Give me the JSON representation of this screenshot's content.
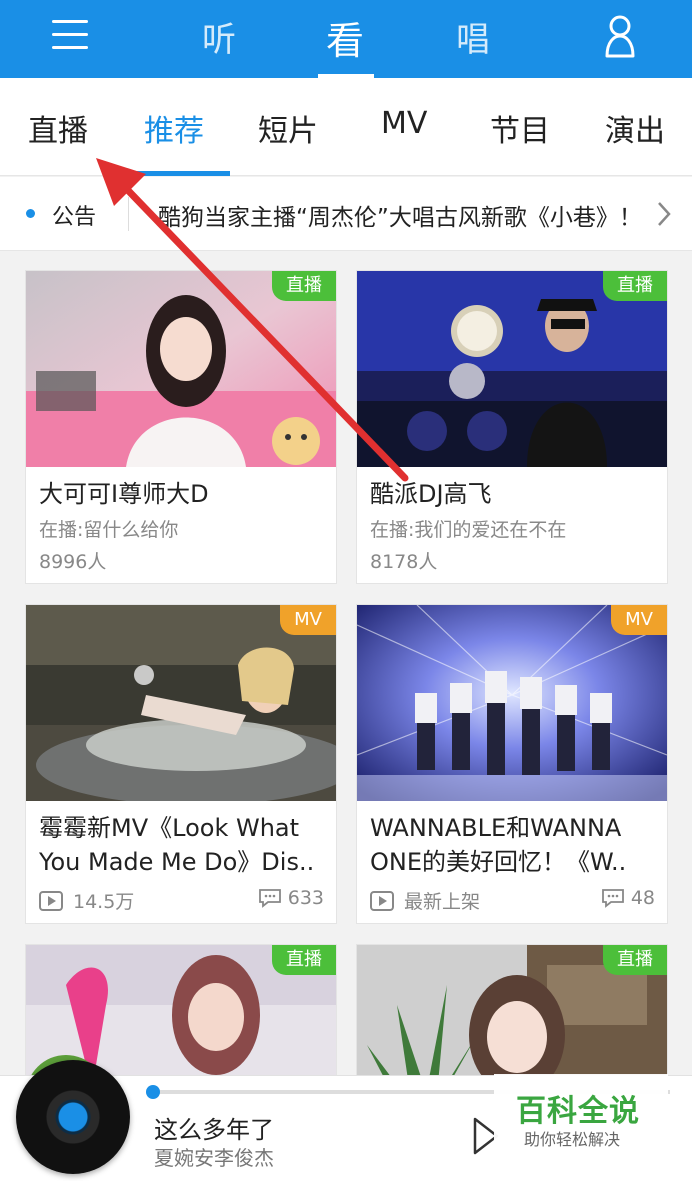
{
  "top_nav": {
    "tabs": [
      "听",
      "看",
      "唱"
    ],
    "active": "看",
    "menu_icon": "menu-icon",
    "user_icon": "user-icon"
  },
  "categories": {
    "items": [
      "直播",
      "推荐",
      "短片",
      "MV",
      "节目",
      "演出"
    ],
    "active": "推荐"
  },
  "notice": {
    "label": "公告",
    "text": "酷狗当家主播“周杰伦”大唱古风新歌《小巷》！"
  },
  "cards": [
    {
      "badge": "直播",
      "title": "大可可I尊师大D",
      "subtitle": "在播:留什么给你",
      "count": "8996人"
    },
    {
      "badge": "直播",
      "title": "酷派DJ高飞",
      "subtitle": "在播:我们的爱还在不在",
      "count": "8178人"
    },
    {
      "badge": "MV",
      "title": "霉霉新MV《Look What You Made Me Do》Dis..",
      "plays": "14.5万",
      "comments": "633"
    },
    {
      "badge": "MV",
      "title": "WANNABLE和WANNA ONE的美好回忆！《W..",
      "plays": "最新上架",
      "comments": "48"
    },
    {
      "badge": "直播"
    },
    {
      "badge": "直播"
    }
  ],
  "player": {
    "song": "这么多年了",
    "artist": "夏婉安李俊杰",
    "progress": 0.01
  },
  "watermark": {
    "title": "百科全说",
    "tagline": "助你轻松解决"
  },
  "colors": {
    "accent": "#1a8fe6",
    "live_badge": "#4cbf3a",
    "mv_badge": "#f0a22a",
    "annotation_arrow": "#e03030"
  }
}
